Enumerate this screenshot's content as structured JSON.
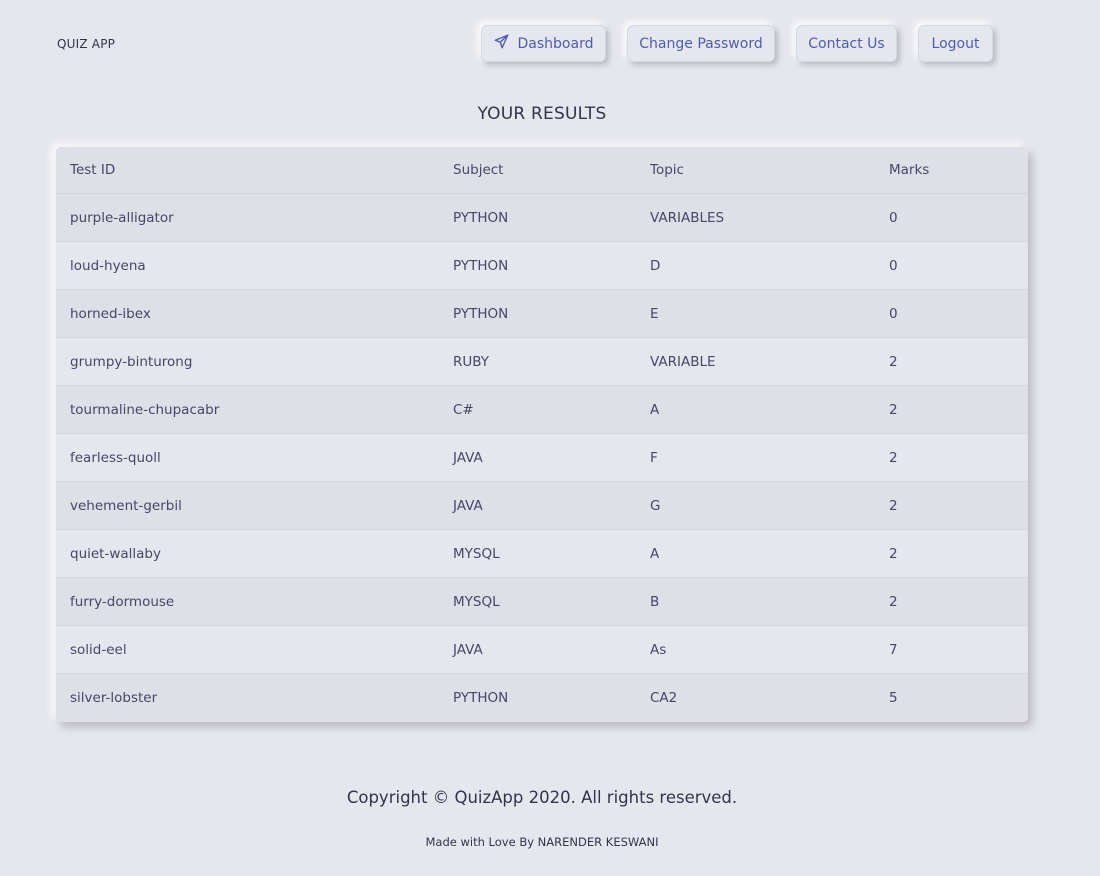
{
  "brand": "QUIZ APP",
  "nav": {
    "dashboard": "Dashboard",
    "change_password": "Change Password",
    "contact": "Contact Us",
    "logout": "Logout",
    "dashboard_icon": "paper-plane-icon",
    "accent_color": "#4c5bb5"
  },
  "results_title": "YOUR RESULTS",
  "table": {
    "headers": [
      "Test ID",
      "Subject",
      "Topic",
      "Marks"
    ],
    "rows": [
      [
        "purple-alligator",
        "PYTHON",
        "VARIABLES",
        "0"
      ],
      [
        "loud-hyena",
        "PYTHON",
        "D",
        "0"
      ],
      [
        "horned-ibex",
        "PYTHON",
        "E",
        "0"
      ],
      [
        "grumpy-binturong",
        "RUBY",
        "VARIABLE",
        "2"
      ],
      [
        "tourmaline-chupacabr",
        "C#",
        "A",
        "2"
      ],
      [
        "fearless-quoll",
        "JAVA",
        "F",
        "2"
      ],
      [
        "vehement-gerbil",
        "JAVA",
        "G",
        "2"
      ],
      [
        "quiet-wallaby",
        "MYSQL",
        "A",
        "2"
      ],
      [
        "furry-dormouse",
        "MYSQL",
        "B",
        "2"
      ],
      [
        "solid-eel",
        "JAVA",
        "As",
        "7"
      ],
      [
        "silver-lobster",
        "PYTHON",
        "CA2",
        "5"
      ]
    ]
  },
  "footer": {
    "copyright": "Copyright © QuizApp 2020. All rights reserved.",
    "made_by": "Made with Love By NARENDER KESWANI"
  }
}
